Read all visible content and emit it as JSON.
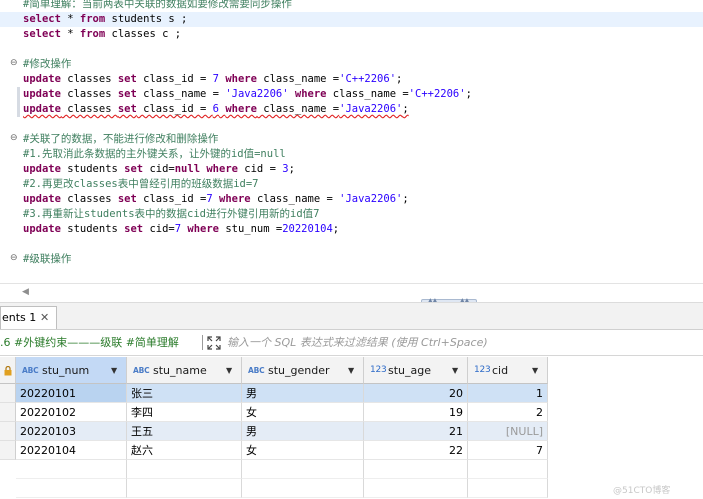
{
  "editor": {
    "lines": [
      {
        "comment": "#简单理解：当前两表中关联的数据如要修改需要同步操作"
      },
      {
        "tokens": [
          [
            "k",
            "select"
          ],
          [
            "p",
            " * "
          ],
          [
            "k",
            "from"
          ],
          [
            "p",
            " students s ;"
          ]
        ]
      },
      {
        "tokens": [
          [
            "k",
            "select"
          ],
          [
            "p",
            " * "
          ],
          [
            "k",
            "from"
          ],
          [
            "p",
            " classes c ;"
          ]
        ]
      },
      {
        "comment": "#修改操作"
      },
      {
        "tokens": [
          [
            "k",
            "update"
          ],
          [
            "p",
            " classes "
          ],
          [
            "k",
            "set"
          ],
          [
            "p",
            " class_id = "
          ],
          [
            "n",
            "7"
          ],
          [
            "p",
            " "
          ],
          [
            "k",
            "where"
          ],
          [
            "p",
            " class_name ="
          ],
          [
            "s",
            "'C++2206'"
          ],
          [
            "p",
            ";"
          ]
        ]
      },
      {
        "tokens": [
          [
            "k",
            "update"
          ],
          [
            "p",
            " classes "
          ],
          [
            "k",
            "set"
          ],
          [
            "p",
            " class_name = "
          ],
          [
            "s",
            "'Java2206'"
          ],
          [
            "p",
            " "
          ],
          [
            "k",
            "where"
          ],
          [
            "p",
            " class_name ="
          ],
          [
            "s",
            "'C++2206'"
          ],
          [
            "p",
            ";"
          ]
        ]
      },
      {
        "tokens": [
          [
            "k",
            "update"
          ],
          [
            "p",
            " classes "
          ],
          [
            "k",
            "set"
          ],
          [
            "p",
            " class_id = "
          ],
          [
            "n",
            "6"
          ],
          [
            "p",
            " "
          ],
          [
            "k",
            "where"
          ],
          [
            "p",
            " class_name ="
          ],
          [
            "s",
            "'Java2206'"
          ],
          [
            "p",
            ";"
          ]
        ]
      },
      {
        "comment": "#关联了的数据，不能进行修改和删除操作"
      },
      {
        "comment": "#1.先取消此条数据的主外键关系，让外键的id值=null"
      },
      {
        "tokens": [
          [
            "k",
            "update"
          ],
          [
            "p",
            " students "
          ],
          [
            "k",
            "set"
          ],
          [
            "p",
            " cid="
          ],
          [
            "k",
            "null"
          ],
          [
            "p",
            " "
          ],
          [
            "k",
            "where"
          ],
          [
            "p",
            " cid = "
          ],
          [
            "n",
            "3"
          ],
          [
            "p",
            ";"
          ]
        ]
      },
      {
        "comment": "#2.再更改classes表中曾经引用的班级数据id=7"
      },
      {
        "tokens": [
          [
            "k",
            "update"
          ],
          [
            "p",
            " classes "
          ],
          [
            "k",
            "set"
          ],
          [
            "p",
            " class_id ="
          ],
          [
            "n",
            "7"
          ],
          [
            "p",
            " "
          ],
          [
            "k",
            "where"
          ],
          [
            "p",
            " class_name = "
          ],
          [
            "s",
            "'Java2206'"
          ],
          [
            "p",
            ";"
          ]
        ]
      },
      {
        "comment": "#3.再重新让students表中的数据cid进行外键引用新的id值7"
      },
      {
        "tokens": [
          [
            "k",
            "update"
          ],
          [
            "p",
            " students "
          ],
          [
            "k",
            "set"
          ],
          [
            "p",
            " cid="
          ],
          [
            "n",
            "7"
          ],
          [
            "p",
            " "
          ],
          [
            "k",
            "where"
          ],
          [
            "p",
            " stu_num ="
          ],
          [
            "n",
            "20220104"
          ],
          [
            "p",
            ";"
          ]
        ]
      },
      {
        "comment": "#级联操作"
      }
    ]
  },
  "results": {
    "tab_label": "ents 1",
    "tab_close": "✕",
    "filter_query": ".6 #外键约束———级联 #简单理解",
    "filter_placeholder": "输入一个 SQL 表达式来过滤结果 (使用 Ctrl+Space)",
    "type_badges": {
      "text": "ABC",
      "number": "123"
    },
    "columns": [
      {
        "name": "stu_num",
        "type": "text"
      },
      {
        "name": "stu_name",
        "type": "text"
      },
      {
        "name": "stu_gender",
        "type": "text"
      },
      {
        "name": "stu_age",
        "type": "number"
      },
      {
        "name": "cid",
        "type": "number"
      }
    ],
    "rows": [
      [
        "20220101",
        "张三",
        "男",
        "20",
        "1"
      ],
      [
        "20220102",
        "李四",
        "女",
        "19",
        "2"
      ],
      [
        "20220103",
        "王五",
        "男",
        "21",
        "[NULL]"
      ],
      [
        "20220104",
        "赵六",
        "女",
        "22",
        "7"
      ]
    ]
  },
  "watermark": "@51CTO博客",
  "colors": {
    "keyword": "#7f0055",
    "string": "#2a00ff",
    "comment": "#3f7f5f",
    "selected_row": "#cfe1f5"
  }
}
